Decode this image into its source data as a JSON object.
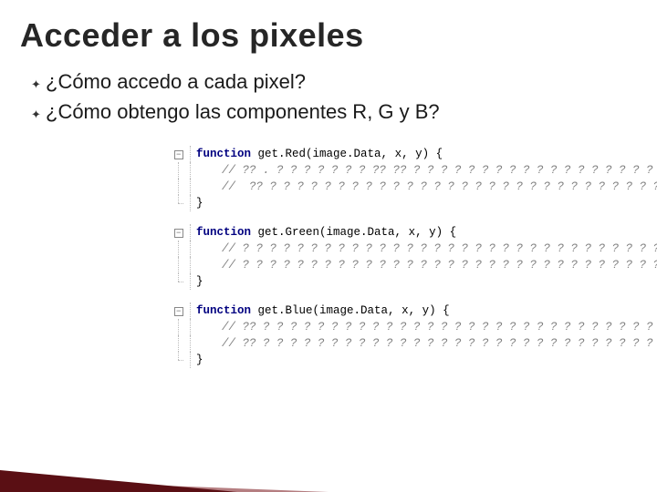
{
  "title": "Acceder a los pixeles",
  "bullets": [
    "¿Cómo accedo a cada pixel?",
    "¿Cómo obtengo las componentes R, G y B?"
  ],
  "code": {
    "blocks": [
      {
        "signature": {
          "kw": "function",
          "name": "get.Red",
          "params": "(image.Data, x, y) {"
        },
        "body": [
          "// ?? . ? ? ? ? ? ? ? ?? ?? ? ? ? ? ? ? ? ? ? ? ? ? ? ? ? ? ? ? ? ?",
          "//  ?? ? ? ? ? ? ? ? ? ? ? ? ? ? ? ? ? ? ? ? ? ? ? ? ? ? ? ? ? ? ? ? ?"
        ],
        "close": "}"
      },
      {
        "signature": {
          "kw": "function",
          "name": "get.Green",
          "params": "(image.Data, x, y) {"
        },
        "body": [
          "// ? ? ? ? ? ? ? ? ? ? ? ? ? ? ? ? ? ? ? ? ? ? ? ? ? ? ? ? ? ? ? ? ? ?",
          "// ? ? ? ? ? ? ? ? ? ? ? ? ? ? ? ? ? ? ? ? ? ? ? ? ? ? ? ? ? ? ? ? ? ? ?"
        ],
        "close": "}"
      },
      {
        "signature": {
          "kw": "function",
          "name": "get.Blue",
          "params": "(image.Data, x, y) {"
        },
        "body": [
          "// ?? ? ? ? ? ? ? ? ? ? ? ? ? ? ? ? ? ? ? ? ? ? ? ? ? ? ? ? ? ? ? ? ?",
          "// ?? ? ? ? ? ? ? ? ? ? ? ? ? ? ? ? ? ? ? ? ? ? ? ? ? ? ? ? ? ? ? ? ?"
        ],
        "close": "}"
      }
    ]
  }
}
